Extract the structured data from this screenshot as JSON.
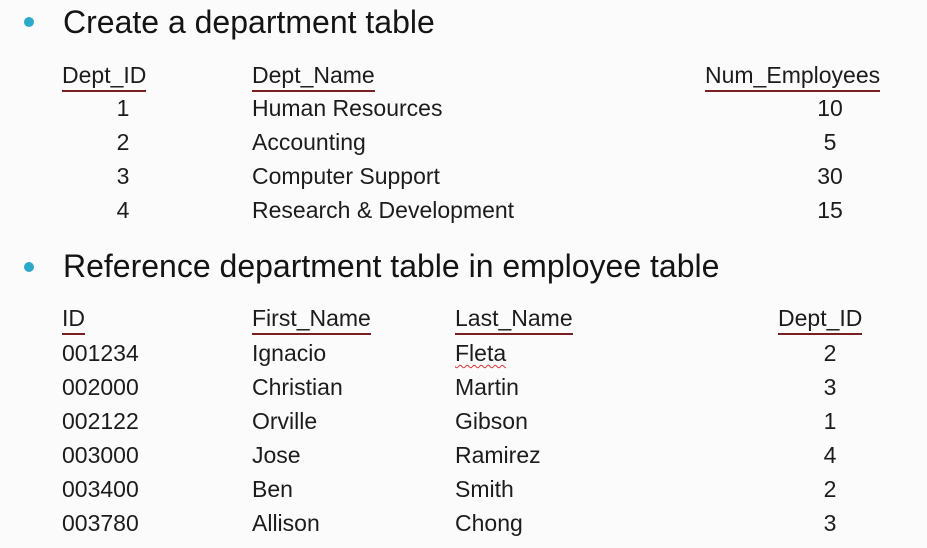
{
  "sections": [
    {
      "bullet": "Create a department table",
      "columns": [
        "Dept_ID",
        "Dept_Name",
        "Num_Employees"
      ],
      "rows": [
        [
          "1",
          "Human Resources",
          "10"
        ],
        [
          "2",
          "Accounting",
          "5"
        ],
        [
          "3",
          "Computer Support",
          "30"
        ],
        [
          "4",
          "Research & Development",
          "15"
        ]
      ]
    },
    {
      "bullet": "Reference department table in employee table",
      "columns": [
        "ID",
        "First_Name",
        "Last_Name",
        "Dept_ID"
      ],
      "rows": [
        [
          "001234",
          "Ignacio",
          "Fleta",
          "2"
        ],
        [
          "002000",
          "Christian",
          "Martin",
          "3"
        ],
        [
          "002122",
          "Orville",
          "Gibson",
          "1"
        ],
        [
          "003000",
          "Jose",
          "Ramirez",
          "4"
        ],
        [
          "003400",
          "Ben",
          "Smith",
          "2"
        ],
        [
          "003780",
          "Allison",
          "Chong",
          "3"
        ]
      ]
    }
  ],
  "colors": {
    "bullet": "#2aa9c9",
    "header_underline": "#7a1f1f",
    "spellcheck": "#dd3333"
  }
}
